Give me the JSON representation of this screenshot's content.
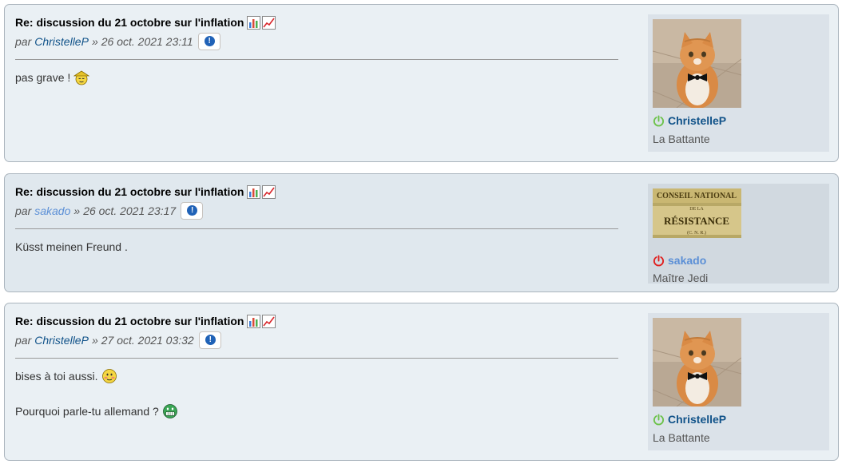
{
  "posts": [
    {
      "title": "Re: discussion du 21 octobre sur l'inflation",
      "by": "par",
      "author": "ChristelleP",
      "sep": "»",
      "date": "26 oct. 2021 23:11",
      "lines": [
        {
          "text": "pas grave !",
          "smiley": "chinese-hat-smiley-icon"
        }
      ],
      "profile": {
        "username": "ChristelleP",
        "rank": "La Battante",
        "status": "online",
        "avatar": "cat-bowtie-avatar"
      }
    },
    {
      "title": "Re: discussion du 21 octobre sur l'inflation",
      "by": "par",
      "author": "sakado",
      "sep": "»",
      "date": "26 oct. 2021 23:17",
      "lines": [
        {
          "text": "Küsst meinen Freund ."
        }
      ],
      "profile": {
        "username": "sakado",
        "rank": "Maître Jedi",
        "status": "offline",
        "avatar": "resistance-sign-avatar",
        "avatar_text": [
          "CONSEIL NATIONAL",
          "DE LA",
          "RÉSISTANCE",
          "(C. N. R.)"
        ]
      }
    },
    {
      "title": "Re: discussion du 21 octobre sur l'inflation",
      "by": "par",
      "author": "ChristelleP",
      "sep": "»",
      "date": "27 oct. 2021 03:32",
      "lines": [
        {
          "text": "bises à toi aussi.",
          "smiley": "blushing-smiley-icon"
        },
        {
          "text": "Pourquoi parle-tu allemand ?",
          "smiley": "green-grin-smiley-icon"
        }
      ],
      "profile": {
        "username": "ChristelleP",
        "rank": "La Battante",
        "status": "online",
        "avatar": "cat-bowtie-avatar"
      }
    }
  ],
  "colors": {
    "online": "#6cc24a",
    "offline": "#e0201f",
    "link": "#105289",
    "guest_link": "#5b8fd6"
  }
}
